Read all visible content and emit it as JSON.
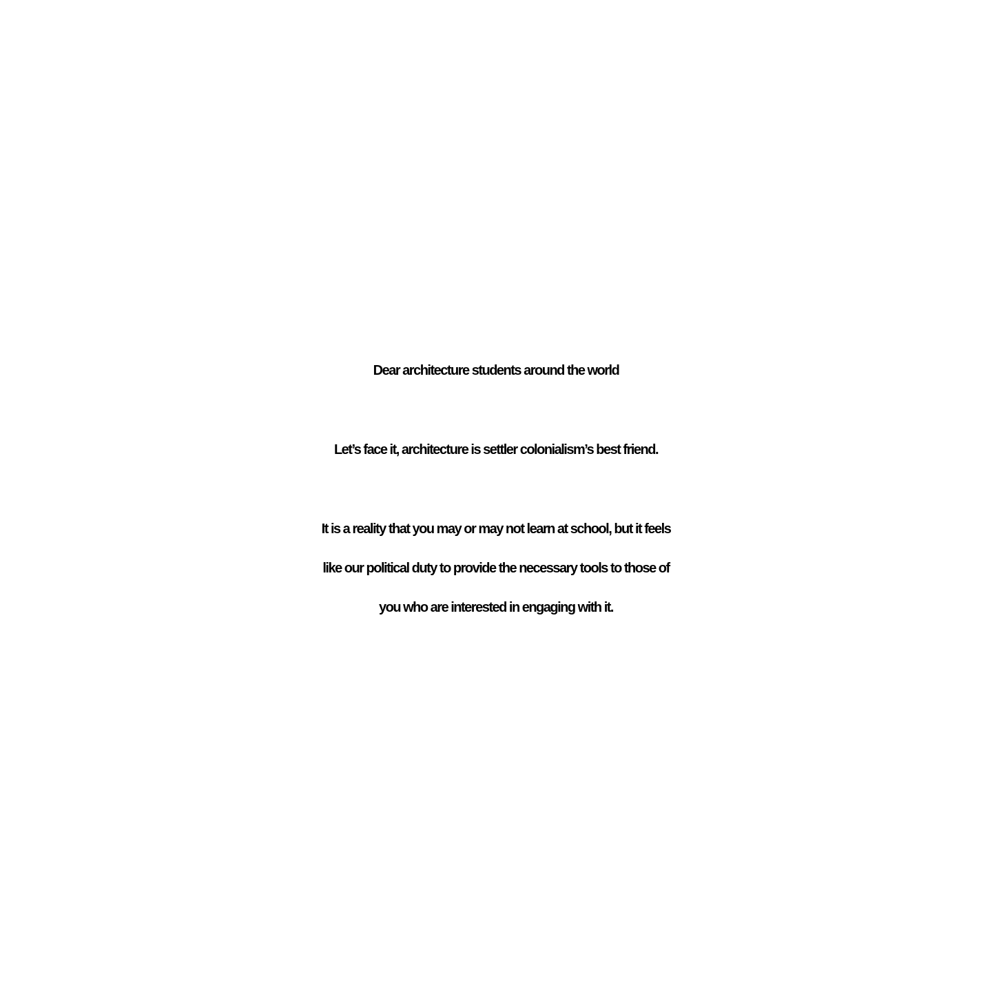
{
  "colors": {
    "background": "#ffffff",
    "text": "#000000"
  },
  "letter": {
    "greeting": "Dear architecture students around the world",
    "statement": "Let’s face it, architecture is settler colonialism’s best friend.",
    "body_lines": [
      "It is a reality that  you may or may not learn at school, but it feels",
      "like our political duty to provide the necessary tools to those of",
      "you who are interested in engaging with it."
    ]
  }
}
